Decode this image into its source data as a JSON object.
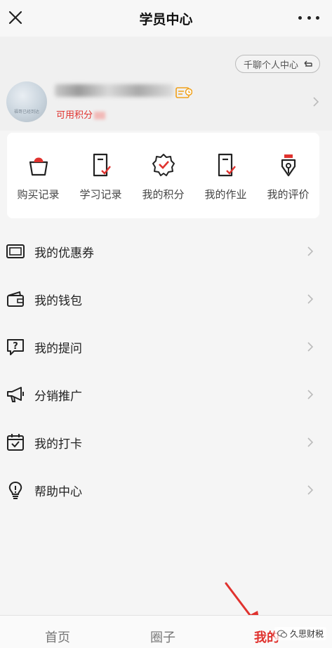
{
  "header": {
    "title": "学员中心"
  },
  "profile": {
    "switch_label": "千聊个人中心",
    "points_label": "可用积分",
    "avatar_caption": "福哥已经到达"
  },
  "quick_actions": [
    {
      "label": "购买记录",
      "icon": "shopping-bag-icon"
    },
    {
      "label": "学习记录",
      "icon": "study-record-icon"
    },
    {
      "label": "我的积分",
      "icon": "points-badge-icon"
    },
    {
      "label": "我的作业",
      "icon": "homework-icon"
    },
    {
      "label": "我的评价",
      "icon": "review-pen-icon"
    }
  ],
  "menu": [
    {
      "label": "我的优惠券",
      "icon": "coupon-icon"
    },
    {
      "label": "我的钱包",
      "icon": "wallet-icon"
    },
    {
      "label": "我的提问",
      "icon": "question-icon"
    },
    {
      "label": "分销推广",
      "icon": "megaphone-icon"
    },
    {
      "label": "我的打卡",
      "icon": "calendar-check-icon"
    },
    {
      "label": "帮助中心",
      "icon": "lightbulb-icon"
    }
  ],
  "tabbar": {
    "home": "首页",
    "circle": "圈子",
    "mine": "我的"
  },
  "watermark": "久思财税",
  "colors": {
    "accent": "#e0322e",
    "background": "#f5f5f5"
  }
}
